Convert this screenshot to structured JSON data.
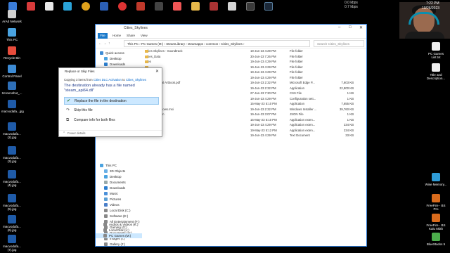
{
  "taskbar_icons": [
    "mail-icon",
    "store-icon",
    "browser-icon",
    "edge-icon",
    "chrome-icon",
    "files-icon",
    "record-icon",
    "app-icon",
    "app-icon",
    "camera-icon",
    "folder-icon",
    "media-icon",
    "app-icon",
    "app-icon",
    "steam-icon"
  ],
  "tray": {
    "upload": "0.0 kbps",
    "download": "0.7 kbps",
    "time": "7:22 PM",
    "date": "10/26/2023"
  },
  "desktop_left": [
    {
      "label": "ArAd Network"
    },
    {
      "label": "This PC"
    },
    {
      "label": "Recycle Bin"
    },
    {
      "label": "Control Panel"
    },
    {
      "label": "Screenshot_..."
    },
    {
      "label": "macvodafa...jpg"
    },
    {
      "label": "macvodafa... (2).jpg"
    },
    {
      "label": "macvodafa... (3).jpg"
    },
    {
      "label": "macvodafa... (4).jpg"
    },
    {
      "label": "macvodafa... (5).jpg"
    },
    {
      "label": "macvodafa... (6).jpg"
    },
    {
      "label": "macvodafa... (7).jpg"
    }
  ],
  "desktop_right": [
    {
      "label": "PC Games List.txt"
    },
    {
      "label": "Title and Description..."
    },
    {
      "label": "Wise Memory..."
    },
    {
      "label": "FreeFire - BS Pro"
    },
    {
      "label": "FreeFire - BS Kaiu Mlah"
    },
    {
      "label": "BlueStacks 5"
    }
  ],
  "explorer": {
    "title": "Cities_Skylines",
    "ribbon_tabs": [
      "File",
      "Home",
      "Share",
      "View"
    ],
    "address": "This PC  ›  PC Games (M:)  ›  SteamLibrary  ›  steamapps  ›  common  ›  Cities_Skylines  ›",
    "search_placeholder": "Search Cities_Skylines",
    "nav": [
      {
        "label": "Quick access",
        "icon": "star-icon"
      },
      {
        "label": "Desktop",
        "icon": "desktop-icon"
      },
      {
        "label": "Downloads",
        "icon": "download-icon"
      },
      {
        "label": "Documents",
        "icon": "document-icon"
      },
      {
        "label": "Pictures",
        "icon": "pictures-icon"
      },
      {
        "label": "This PC",
        "icon": "pc-icon"
      },
      {
        "label": "3D Objects",
        "icon": "cube-icon"
      },
      {
        "label": "Desktop",
        "icon": "desktop-icon"
      },
      {
        "label": "Documents",
        "icon": "document-icon"
      },
      {
        "label": "Downloads",
        "icon": "download-icon"
      },
      {
        "label": "Music",
        "icon": "music-icon"
      },
      {
        "label": "Pictures",
        "icon": "pictures-icon"
      },
      {
        "label": "Videos",
        "icon": "video-icon"
      },
      {
        "label": "Local Disk (C:)",
        "icon": "drive-icon"
      },
      {
        "label": "Software (E:)",
        "icon": "drive-icon"
      },
      {
        "label": "All Entertainment (F:)",
        "icon": "drive-icon"
      },
      {
        "label": "Gaming (G:)",
        "icon": "drive-icon"
      },
      {
        "label": "Documents (H:)",
        "icon": "drive-icon"
      },
      {
        "label": "Images (I:)",
        "icon": "drive-icon"
      },
      {
        "label": "Gallery (J:)",
        "icon": "drive-icon"
      },
      {
        "label": "Audios & Videos (K:)",
        "icon": "drive-icon"
      },
      {
        "label": "Local Disk (L:)",
        "icon": "drive-icon"
      },
      {
        "label": "PC Games (M:)",
        "icon": "drive-icon"
      }
    ],
    "files": [
      {
        "name": "Cities Skylines - Soundtrack",
        "date": "19-Jun-23 4:29 PM",
        "type": "File folder",
        "size": "",
        "kind": "folder"
      },
      {
        "name": "Cities_Data",
        "date": "30-Jun-23 7:26 PM",
        "type": "File folder",
        "size": "",
        "kind": "folder"
      },
      {
        "name": "Files",
        "date": "19-Jun-23 4:29 PM",
        "type": "File folder",
        "size": "",
        "kind": "folder"
      },
      {
        "name": "",
        "date": "19-Jun-23 4:29 PM",
        "type": "File folder",
        "size": "",
        "kind": "folder"
      },
      {
        "name": "...oads",
        "date": "19-Jun-23 4:29 PM",
        "type": "File folder",
        "size": "",
        "kind": "folder"
      },
      {
        "name": "",
        "date": "19-Jun-23 4:29 PM",
        "type": "File folder",
        "size": "",
        "kind": "folder"
      },
      {
        "name": "...ines - Digital Artbook.pdf",
        "date": "19-Jun-23 2:32 PM",
        "type": "Microsoft Edge P...",
        "size": "7,603 KB",
        "kind": "pdf"
      },
      {
        "name": "",
        "date": "19-Jun-23 2:32 PM",
        "type": "Application",
        "size": "22,900 KB",
        "kind": "file"
      },
      {
        "name": "",
        "date": "27-Jun-23 7:30 PM",
        "type": "CSS File",
        "size": "1 KB",
        "kind": "file"
      },
      {
        "name": "",
        "date": "19-Jun-23 4:29 PM",
        "type": "Configuration sett...",
        "size": "1 KB",
        "kind": "file"
      },
      {
        "name": "",
        "date": "15-May-23 5:10 PM",
        "type": "Application",
        "size": "7,655 KB",
        "kind": "file"
      },
      {
        "name": "...staller-windows.msi",
        "date": "19-Jun-23 2:32 PM",
        "type": "Windows Installer ...",
        "size": "39,760 KB",
        "kind": "file"
      },
      {
        "name": "...settings.json",
        "date": "19-Jun-23 3:07 PM",
        "type": "JSON File",
        "size": "1 KB",
        "kind": "file"
      },
      {
        "name": "",
        "date": "15-May-23 5:10 PM",
        "type": "Application exten...",
        "size": "1 KB",
        "kind": "file"
      },
      {
        "name": "...dll",
        "date": "19-Jun-23 4:29 PM",
        "type": "Application exten...",
        "size": "234 KB",
        "kind": "file"
      },
      {
        "name": "...64_o.dll",
        "date": "19-May-23 5:12 PM",
        "type": "Application exten...",
        "size": "234 KB",
        "kind": "file"
      },
      {
        "name": "...icenses.txt",
        "date": "19-Jun-23 4:29 PM",
        "type": "Text Document",
        "size": "33 KB",
        "kind": "file"
      }
    ]
  },
  "dialog": {
    "title": "Replace or Skip Files",
    "copying_prefix": "Copying 3 items from",
    "from": "Cities DLC Activation",
    "to_word": "to",
    "to": "Cities_Skylines",
    "message": "The destination already has a file named \"steam_api64.dll\"",
    "options": [
      {
        "label": "Replace the file in the destination",
        "icon": "check-icon",
        "selected": true
      },
      {
        "label": "Skip this file",
        "icon": "skip-icon",
        "selected": false
      },
      {
        "label": "Compare info for both files",
        "icon": "compare-icon",
        "selected": false
      }
    ],
    "fewer_details": "Fewer details"
  }
}
